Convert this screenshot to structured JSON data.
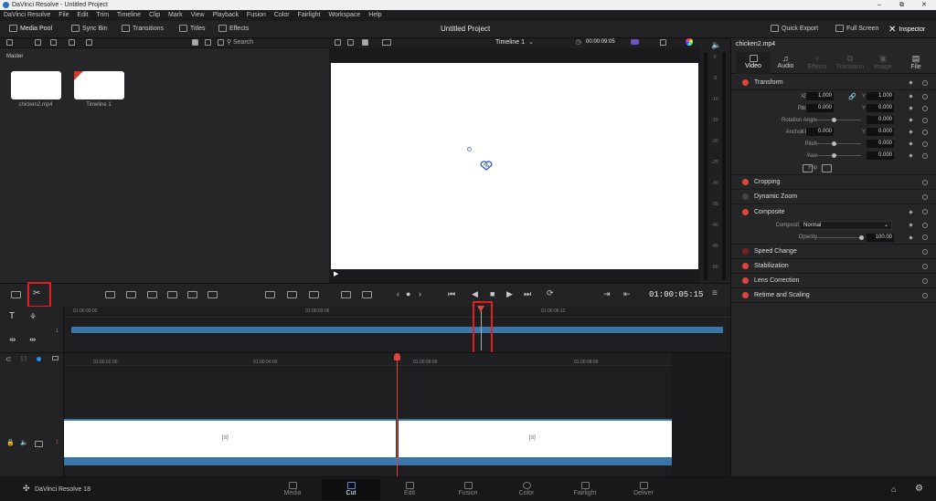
{
  "window": {
    "title": "DaVinci Resolve - Untitled Project",
    "controls": [
      "–",
      "⧉",
      "✕"
    ]
  },
  "menu": [
    "DaVinci Resolve",
    "File",
    "Edit",
    "Trim",
    "Timeline",
    "Clip",
    "Mark",
    "View",
    "Playback",
    "Fusion",
    "Color",
    "Fairlight",
    "Workspace",
    "Help"
  ],
  "toolbar": {
    "media_pool": "Media Pool",
    "sync_bin": "Sync Bin",
    "transitions": "Transitions",
    "titles": "Titles",
    "effects": "Effects",
    "project_title": "Untitled Project",
    "quick_export": "Quick Export",
    "full_screen": "Full Screen",
    "inspector": "Inspector"
  },
  "media_pool": {
    "search_placeholder": "Search",
    "bin": "Master",
    "clips": [
      {
        "name": "chicken2.mp4"
      },
      {
        "name": "Timeline 1"
      }
    ]
  },
  "viewer": {
    "timeline_name": "Timeline 1",
    "source_tc": "00:00:09:05",
    "timecode": "01:00:05:15"
  },
  "meters": {
    "labels": [
      "0",
      "-5",
      "-10",
      "-15",
      "-20",
      "-25",
      "-30",
      "-35",
      "-40",
      "-45",
      "-50"
    ]
  },
  "inspector": {
    "clip_name": "chicken2.mp4",
    "tabs": [
      "Video",
      "Audio",
      "Effects",
      "Transition",
      "Image",
      "File"
    ],
    "transform": {
      "title": "Transform",
      "zoom_label": "Zoom",
      "zoom_x": "1.000",
      "zoom_y": "1.000",
      "position_label": "Position",
      "pos_x": "0.000",
      "pos_y": "0.000",
      "rotation_label": "Rotation Angle",
      "rotation": "0.000",
      "anchor_label": "Anchor Point",
      "anchor_x": "0.000",
      "anchor_y": "0.000",
      "pitch_label": "Pitch",
      "pitch": "0.000",
      "yaw_label": "Yaw",
      "yaw": "0.000",
      "flip_label": "Flip",
      "x": "X",
      "y": "Y"
    },
    "cropping": "Cropping",
    "dynamic_zoom": "Dynamic Zoom",
    "composite": {
      "title": "Composite",
      "mode_label": "Composite Mode",
      "mode": "Normal",
      "opacity_label": "Opacity",
      "opacity": "100.00"
    },
    "sections": [
      "Speed Change",
      "Stabilization",
      "Lens Correction",
      "Retime and Scaling"
    ]
  },
  "timeline_upper": {
    "ticks": [
      "01:00:00:00",
      "01:00:03:06",
      "01:00:06:12"
    ]
  },
  "timeline_lower": {
    "ticks": [
      "01:00:02:00",
      "01:00:04:00",
      "01:00:06:00",
      "01:00:08:00"
    ],
    "track_num": "1",
    "clip_glyph": "[≡]"
  },
  "pages": [
    "Media",
    "Cut",
    "Edit",
    "Fusion",
    "Color",
    "Fairlight",
    "Deliver"
  ],
  "app_name": "DaVinci Resolve 18"
}
